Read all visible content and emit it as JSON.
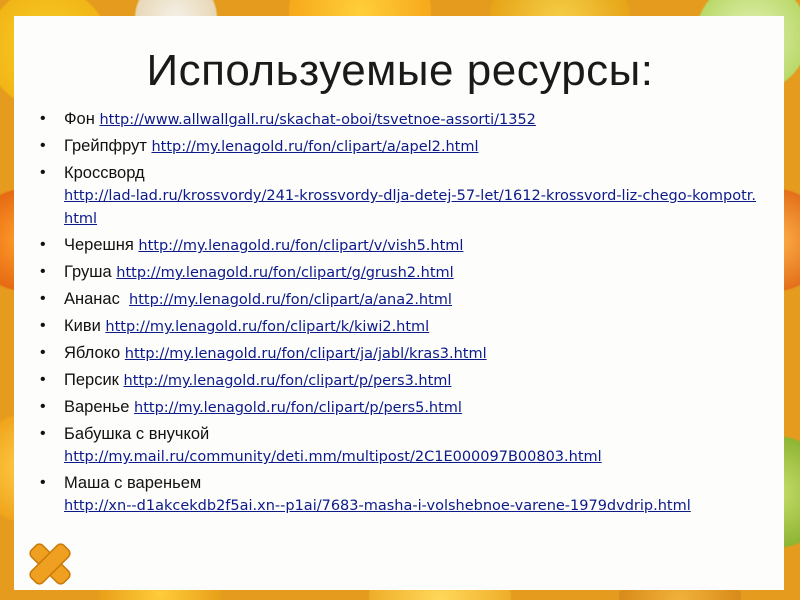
{
  "slide": {
    "title": "Используемые ресурсы:",
    "items": [
      {
        "label": "Фон",
        "url": "http://www.allwallgall.ru/skachat-oboi/tsvetnoe-assorti/1352"
      },
      {
        "label": "Грейпфрут",
        "url": "http://my.lenagold.ru/fon/clipart/a/apel2.html"
      },
      {
        "label": "Кроссворд",
        "url": "http://lad-lad.ru/krossvordy/241-krossvordy-dlja-detej-57-let/1612-krossvord-liz-chego-kompotr.html"
      },
      {
        "label": "Черешня",
        "url": "http://my.lenagold.ru/fon/clipart/v/vish5.html"
      },
      {
        "label": "Груша",
        "url": "http://my.lenagold.ru/fon/clipart/g/grush2.html"
      },
      {
        "label": "Ананас",
        "url": "http://my.lenagold.ru/fon/clipart/a/ana2.html"
      },
      {
        "label": "Киви",
        "url": "http://my.lenagold.ru/fon/clipart/k/kiwi2.html"
      },
      {
        "label": "Яблоко",
        "url": "http://my.lenagold.ru/fon/clipart/ja/jabl/kras3.html"
      },
      {
        "label": "Персик",
        "url": "http://my.lenagold.ru/fon/clipart/p/pers3.html"
      },
      {
        "label": "Варенье",
        "url": "http://my.lenagold.ru/fon/clipart/p/pers5.html"
      },
      {
        "label": "Бабушка с внучкой",
        "url": "http://my.mail.ru/community/deti.mm/multipost/2C1E000097B00803.html"
      },
      {
        "label": "Маша с вареньем",
        "url": "http://xn--d1akcekdb2f5ai.xn--p1ai/7683-masha-i-volshebnoe-varene-1979dvdrip.html"
      }
    ]
  },
  "close_icon": "close-icon",
  "colors": {
    "link": "#0d1a8a",
    "close": "#f0a020"
  }
}
